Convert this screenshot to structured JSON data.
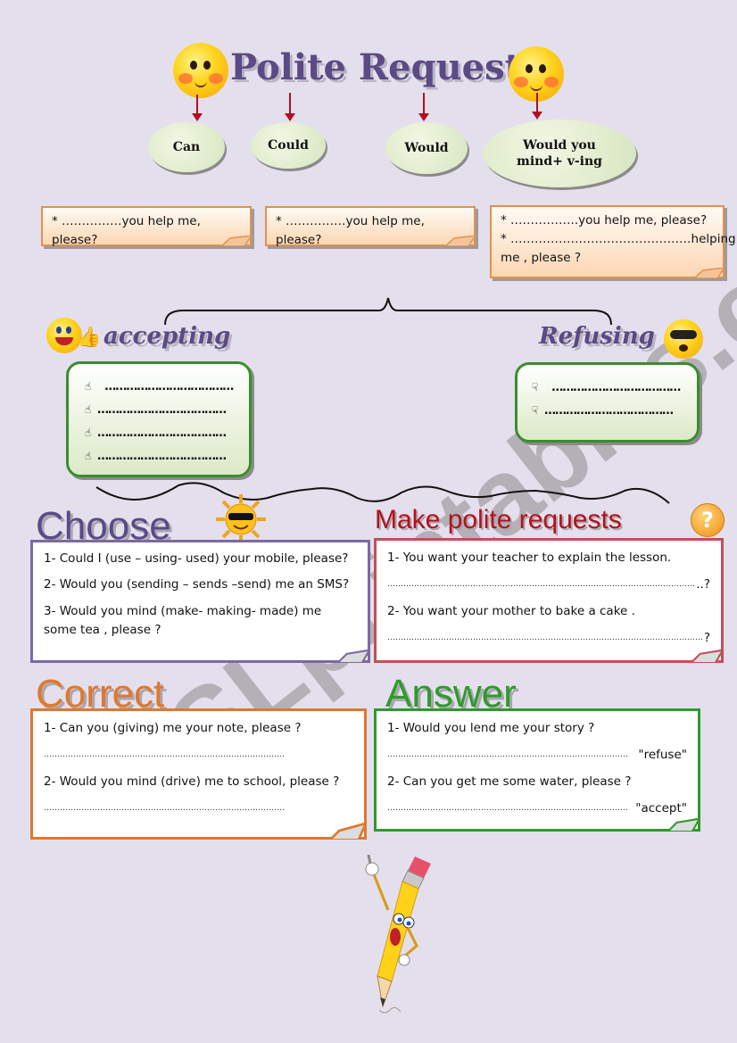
{
  "title": "Polite Requests",
  "modals": [
    {
      "label": "Can"
    },
    {
      "label": "Could"
    },
    {
      "label": "Would"
    },
    {
      "label_line1": "Would you",
      "label_line2": "mind+ v-ing"
    }
  ],
  "notes": [
    {
      "lines": [
        "* ……………you help me, please?"
      ]
    },
    {
      "lines": [
        "* ……………you help me, please?"
      ]
    },
    {
      "lines": [
        "* ……………..you help me, please?",
        "* ………………………………………helping",
        "me , please ?"
      ]
    }
  ],
  "accepting": {
    "heading": "accepting",
    "bullet_icon": "thumbs-up-icon",
    "lines": [
      "………………………………",
      "………………………………",
      "………………………………",
      "………………………………"
    ]
  },
  "refusing": {
    "heading": "Refusing",
    "bullet_icon": "thumbs-down-icon",
    "lines": [
      "………………………………",
      "………………………………"
    ]
  },
  "choose": {
    "heading": "Choose",
    "color": "#5b4a86",
    "items": [
      "1- Could I (use – using- used) your mobile, please?",
      "2- Would you (sending – sends –send) me an SMS?",
      "3- Would you mind (make- making- made) me",
      "some tea , please ?"
    ]
  },
  "make_requests": {
    "heading": "Make polite requests",
    "color": "#b3121b",
    "items": [
      {
        "prompt": "1- You want your teacher to explain the lesson.",
        "answer_end": "..?"
      },
      {
        "prompt": "2- You want your mother to bake a cake .",
        "answer_end": "?"
      }
    ]
  },
  "correct": {
    "heading": "Correct",
    "color": "#e0782c",
    "items": [
      "1- Can you (giving) me your note, please ?",
      "2- Would you mind (drive) me to school, please ?"
    ]
  },
  "answer": {
    "heading": "Answer",
    "color": "#2e9a2b",
    "items": [
      {
        "prompt": "1- Would you lend me your story ?",
        "tag": "\"refuse\""
      },
      {
        "prompt": "2- Can you get me some water, please ?",
        "tag": "\"accept\""
      }
    ]
  },
  "dotline": "………………………………………………………………………………………………………………………………",
  "watermark": "ESLprintables.com"
}
